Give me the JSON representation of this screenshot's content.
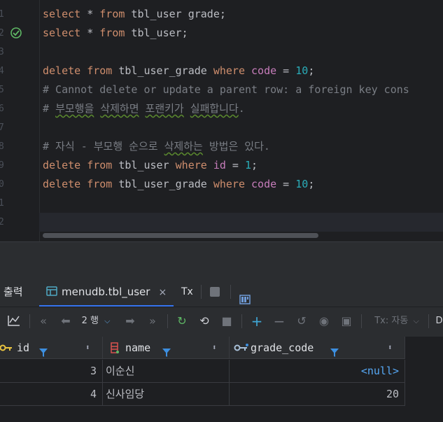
{
  "editor": {
    "gutter": [
      "1",
      "2",
      "3",
      "4",
      "5",
      "6",
      "7",
      "8",
      "9",
      "0",
      "1",
      "2"
    ],
    "lines": [
      [
        {
          "t": "select",
          "c": "kw"
        },
        {
          "t": " * ",
          "c": "op"
        },
        {
          "t": "from",
          "c": "kw"
        },
        {
          "t": " tbl_user grade;",
          "c": "ident"
        }
      ],
      [
        {
          "t": "select",
          "c": "kw"
        },
        {
          "t": " * ",
          "c": "op"
        },
        {
          "t": "from",
          "c": "kw"
        },
        {
          "t": " tbl_user;",
          "c": "ident"
        }
      ],
      [],
      [
        {
          "t": "delete",
          "c": "kw"
        },
        {
          "t": " ",
          "c": "op"
        },
        {
          "t": "from",
          "c": "kw"
        },
        {
          "t": " tbl_user_grade ",
          "c": "ident"
        },
        {
          "t": "where",
          "c": "kw"
        },
        {
          "t": " ",
          "c": "op"
        },
        {
          "t": "code",
          "c": "col"
        },
        {
          "t": " = ",
          "c": "op"
        },
        {
          "t": "10",
          "c": "num-lit"
        },
        {
          "t": ";",
          "c": "op"
        }
      ],
      [
        {
          "t": "# Cannot delete or update a parent row: a foreign key cons",
          "c": "cmt"
        }
      ],
      [
        {
          "t": "# ",
          "c": "cmt"
        },
        {
          "t": "부모행을",
          "c": "cmt warn"
        },
        {
          "t": " ",
          "c": "cmt"
        },
        {
          "t": "삭제하면",
          "c": "cmt warn"
        },
        {
          "t": " ",
          "c": "cmt"
        },
        {
          "t": "포랜키가",
          "c": "cmt warn"
        },
        {
          "t": " ",
          "c": "cmt"
        },
        {
          "t": "실패합니다",
          "c": "cmt warn"
        },
        {
          "t": ".",
          "c": "cmt"
        }
      ],
      [],
      [
        {
          "t": "# 자식 - 부모행 순으로 ",
          "c": "cmt"
        },
        {
          "t": "삭제하는",
          "c": "cmt warn"
        },
        {
          "t": " 방법은 있다.",
          "c": "cmt"
        }
      ],
      [
        {
          "t": "delete",
          "c": "kw"
        },
        {
          "t": " ",
          "c": "op"
        },
        {
          "t": "from",
          "c": "kw"
        },
        {
          "t": " tbl_user ",
          "c": "ident"
        },
        {
          "t": "where",
          "c": "kw"
        },
        {
          "t": " ",
          "c": "op"
        },
        {
          "t": "id",
          "c": "col"
        },
        {
          "t": " = ",
          "c": "op"
        },
        {
          "t": "1",
          "c": "num-lit"
        },
        {
          "t": ";",
          "c": "op"
        }
      ],
      [
        {
          "t": "delete",
          "c": "kw"
        },
        {
          "t": " ",
          "c": "op"
        },
        {
          "t": "from",
          "c": "kw"
        },
        {
          "t": " tbl_user_grade ",
          "c": "ident"
        },
        {
          "t": "where",
          "c": "kw"
        },
        {
          "t": " ",
          "c": "op"
        },
        {
          "t": "code",
          "c": "col"
        },
        {
          "t": " = ",
          "c": "op"
        },
        {
          "t": "10",
          "c": "num-lit"
        },
        {
          "t": ";",
          "c": "op"
        }
      ],
      [],
      []
    ],
    "active_line": 11,
    "executed_line": 1
  },
  "panel": {
    "tabs": {
      "output": "출력",
      "result": "menudb.tbl_user",
      "close": "×",
      "tx": "Tx"
    },
    "toolbar": {
      "rows_label": "2 행",
      "tx_mode": "Tx: 자동",
      "truncated": "D"
    },
    "columns": [
      {
        "name": "id",
        "icon": "primary-key-icon"
      },
      {
        "name": "name",
        "icon": "column-icon"
      },
      {
        "name": "grade_code",
        "icon": "foreign-key-icon"
      }
    ],
    "rows": [
      {
        "id": "3",
        "name": "이순신",
        "grade_code": "<null>"
      },
      {
        "id": "4",
        "name": "신사임당",
        "grade_code": "20"
      }
    ]
  },
  "colors": {
    "keyword": "#cf8e6d",
    "number": "#2aacb8",
    "column_ref": "#c77dbb",
    "comment": "#7a7e85",
    "accent": "#3574f0",
    "null_value": "#56a8f5"
  }
}
